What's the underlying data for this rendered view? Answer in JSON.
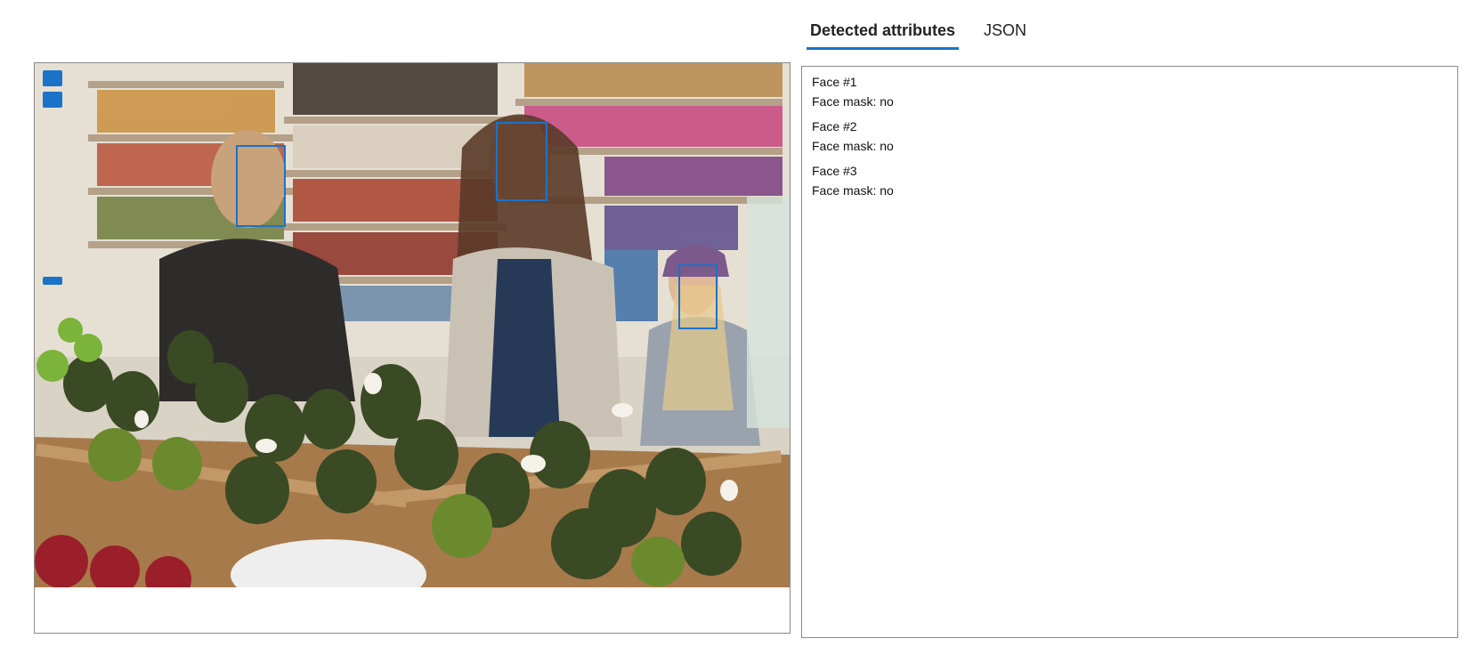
{
  "tabs": [
    {
      "label": "Detected attributes",
      "active": true
    },
    {
      "label": "JSON",
      "active": false
    }
  ],
  "image_panel": {
    "face_boxes": [
      {
        "face": "Face #1"
      },
      {
        "face": "Face #2"
      },
      {
        "face": "Face #3"
      }
    ],
    "box_color": "#1b73c9"
  },
  "results": {
    "faces": [
      {
        "title": "Face #1",
        "mask": "Face mask: no"
      },
      {
        "title": "Face #2",
        "mask": "Face mask: no"
      },
      {
        "title": "Face #3",
        "mask": "Face mask: no"
      }
    ]
  },
  "colors": {
    "accent": "#1b73c9",
    "border": "#8a8a8a"
  }
}
